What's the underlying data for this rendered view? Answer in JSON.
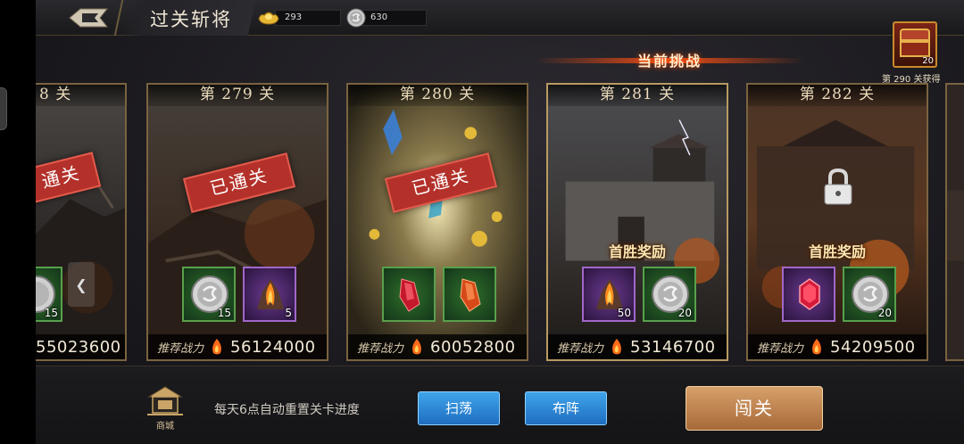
{
  "header": {
    "title": "过关斩将",
    "gold_ingot": "293",
    "silver_coin": "630"
  },
  "chest": {
    "count": "20",
    "note": "第 290 关获得"
  },
  "banner": {
    "current_challenge": "当前挑战"
  },
  "cards": [
    {
      "stage": "8 关",
      "stamp": "通关",
      "power_label": "推荐战力",
      "power": "55023600",
      "items": [
        {
          "qty": "15"
        }
      ]
    },
    {
      "stage": "第 279 关",
      "stamp": "已通关",
      "power_label": "推荐战力",
      "power": "56124000",
      "items": [
        {
          "type": "silver-coin",
          "qty": "15"
        },
        {
          "type": "flame-stone",
          "qty": "5"
        }
      ]
    },
    {
      "stage": "第 280 关",
      "stamp": "已通关",
      "power_label": "推荐战力",
      "power": "60052800",
      "items": [
        {
          "type": "red-crystal",
          "qty": ""
        },
        {
          "type": "orange-crystal",
          "qty": ""
        }
      ]
    },
    {
      "stage": "第 281 关",
      "reward_title": "首胜奖励",
      "power_label": "推荐战力",
      "power": "53146700",
      "items": [
        {
          "type": "flame-stone",
          "qty": "50"
        },
        {
          "type": "silver-coin",
          "qty": "20"
        }
      ]
    },
    {
      "stage": "第 282 关",
      "reward_title": "首胜奖励",
      "locked": true,
      "power_label": "推荐战力",
      "power": "54209500",
      "items": [
        {
          "type": "red-gem",
          "qty": ""
        },
        {
          "type": "silver-coin",
          "qty": "20"
        }
      ]
    }
  ],
  "footer": {
    "shop_label": "商城",
    "reset_tip": "每天6点自动重置关卡进度",
    "sweep_label": "扫荡",
    "formation_label": "布阵",
    "challenge_label": "闯关"
  },
  "colors": {
    "accent_gold": "#7a6340",
    "button_blue": "#1f6ec0",
    "button_bronze": "#a7693a",
    "stamp_red": "#b3312a"
  }
}
